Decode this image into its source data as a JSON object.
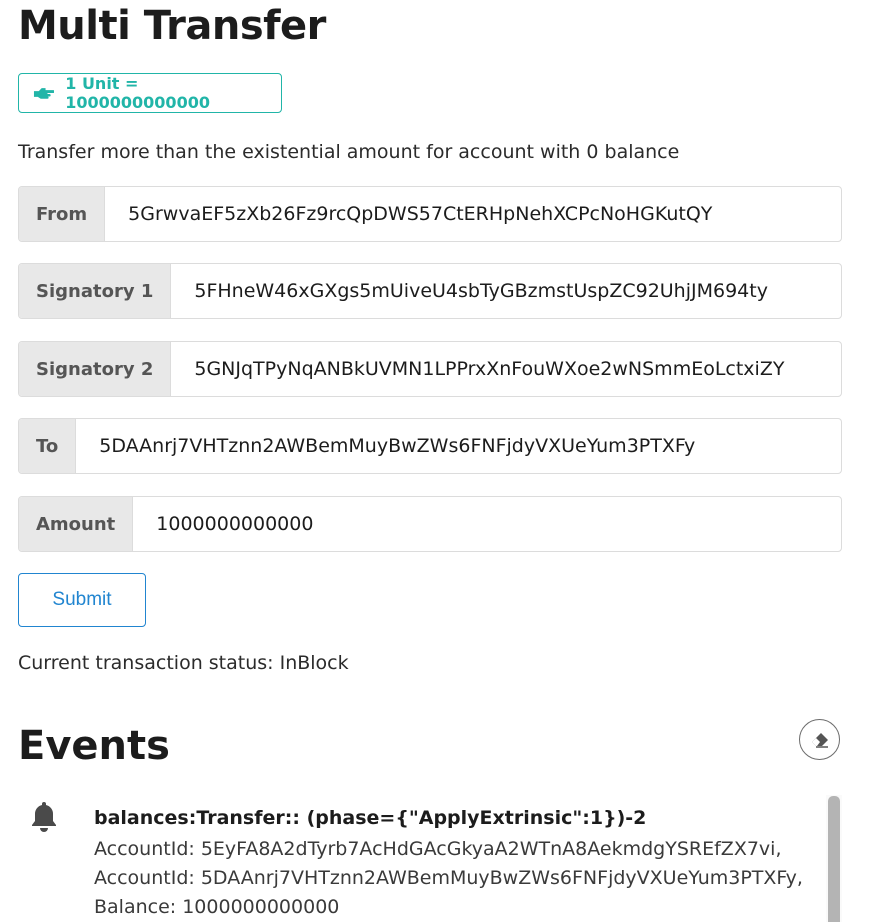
{
  "page": {
    "title": "Multi Transfer"
  },
  "unit_badge": {
    "icon": "hand-pointing-right-icon",
    "label": "1 Unit = 1000000000000"
  },
  "intro": "Transfer more than the existential amount for account with 0 balance",
  "form": {
    "from": {
      "label": "From",
      "value": "5GrwvaEF5zXb26Fz9rcQpDWS57CtERHpNehXCPcNoHGKutQY"
    },
    "signatory1": {
      "label": "Signatory 1",
      "value": "5FHneW46xGXgs5mUiveU4sbTyGBzmstUspZC92UhjJM694ty"
    },
    "signatory2": {
      "label": "Signatory 2",
      "value": "5GNJqTPyNqANBkUVMN1LPPrxXnFouWXoe2wNSmmEoLctxiZY"
    },
    "to": {
      "label": "To",
      "value": "5DAAnrj7VHTznn2AWBemMuyBwZWs6FNFjdyVXUeYum3PTXFy"
    },
    "amount": {
      "label": "Amount",
      "value": "1000000000000"
    },
    "submit_label": "Submit"
  },
  "status": "Current transaction status: InBlock",
  "events": {
    "title": "Events",
    "clear_icon": "eraser-icon",
    "items": [
      {
        "icon": "bell-icon",
        "title": "balances:Transfer:: (phase={\"ApplyExtrinsic\":1})-2",
        "lines": [
          "AccountId: 5EyFA8A2dTyrb7AcHdGAcGkyaA2WTnA8AekmdgYSREfZX7vi,",
          "AccountId: 5DAAnrj7VHTznn2AWBemMuyBwZWs6FNFjdyVXUeYum3PTXFy,",
          "Balance: 1000000000000"
        ]
      }
    ]
  },
  "colors": {
    "teal": "#21b5a8",
    "blue": "#2185d0",
    "label_bg": "#e8e8e8"
  }
}
